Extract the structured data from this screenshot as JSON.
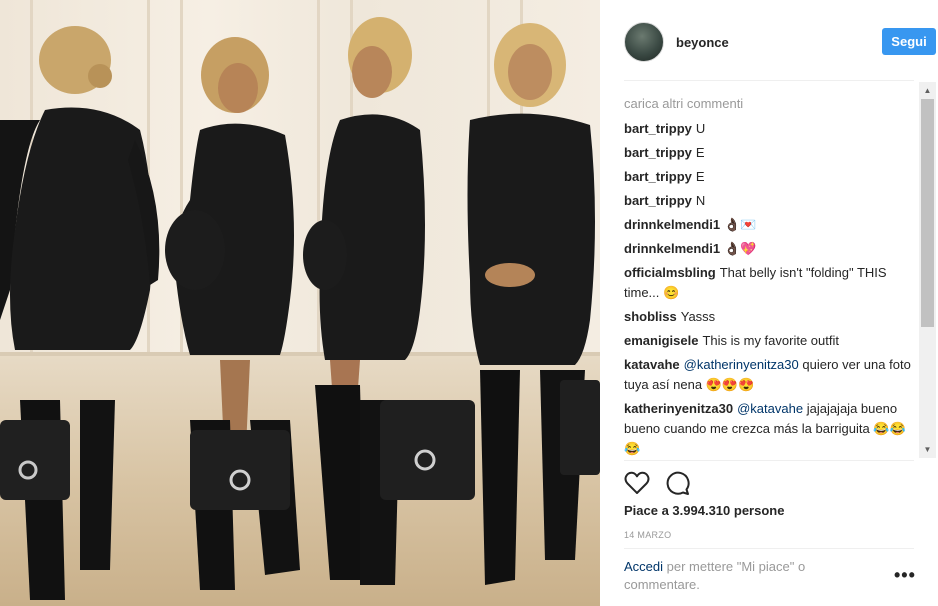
{
  "post": {
    "username": "beyonce",
    "follow_label": "Segui",
    "load_more_label": "carica altri commenti",
    "comments": [
      {
        "user": "bart_trippy",
        "text": "U"
      },
      {
        "user": "bart_trippy",
        "text": "E"
      },
      {
        "user": "bart_trippy",
        "text": "E"
      },
      {
        "user": "bart_trippy",
        "text": "N"
      },
      {
        "user": "drinnkelmendi1",
        "text": "👌🏿💌"
      },
      {
        "user": "drinnkelmendi1",
        "text": "👌🏿💖"
      },
      {
        "user": "officialmsbling",
        "text": "That belly isn't \"folding\" THIS time... 😊"
      },
      {
        "user": "shobliss",
        "text": "Yasss"
      },
      {
        "user": "emanigisele",
        "text": "This is my favorite outfit"
      },
      {
        "user": "katavahe",
        "mention": "@katherinyenitza30",
        "text": "quiero ver una foto tuya así nena 😍😍😍"
      },
      {
        "user": "katherinyenitza30",
        "mention": "@katavahe",
        "text": "jajajajaja bueno bueno cuando me crezca más la barriguita 😂😂😂"
      }
    ],
    "likes_label": "Piace a 3.994.310 persone",
    "date_label": "14 MARZO",
    "login_link": "Accedi",
    "login_rest": "per mettere \"Mi piace\" o commentare.",
    "more_label": "•••",
    "icons": {
      "like": "heart-icon",
      "comment": "comment-bubble-icon",
      "more": "more-options-icon"
    },
    "colors": {
      "accent": "#3897f0",
      "link": "#003569",
      "muted": "#999999"
    }
  }
}
